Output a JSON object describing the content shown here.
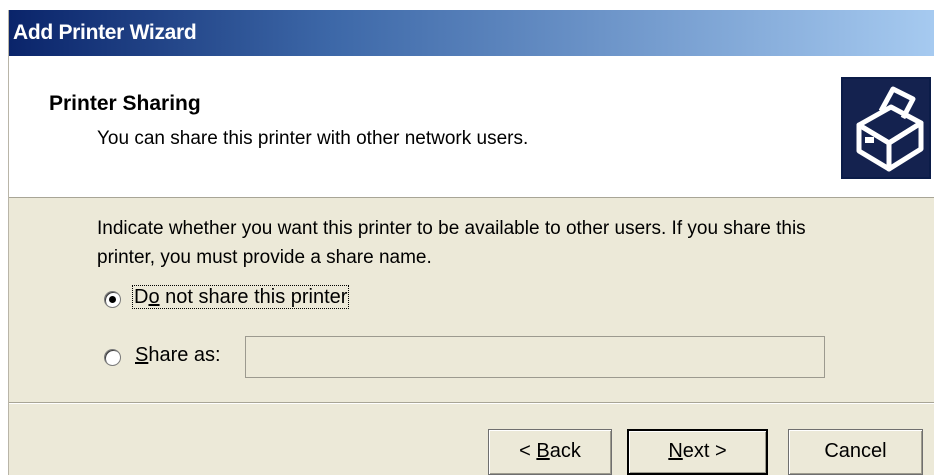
{
  "window": {
    "title": "Add Printer Wizard"
  },
  "header": {
    "title": "Printer Sharing",
    "subtitle": "You can share this printer with other network users.",
    "icon": "printer-icon"
  },
  "body": {
    "instruction": "Indicate whether you want this printer to be available to other users. If you share this printer, you must provide a share name.",
    "option_no_share": {
      "prefix": "D",
      "mnemonic": "o",
      "rest": " not share this printer",
      "selected": true
    },
    "option_share": {
      "prefix": "",
      "mnemonic": "S",
      "rest": "hare as:",
      "selected": false
    },
    "share_name_value": ""
  },
  "buttons": {
    "back": {
      "prefix": "< ",
      "mnemonic": "B",
      "rest": "ack"
    },
    "next": {
      "prefix": "",
      "mnemonic": "N",
      "rest": "ext >"
    },
    "cancel": "Cancel"
  }
}
